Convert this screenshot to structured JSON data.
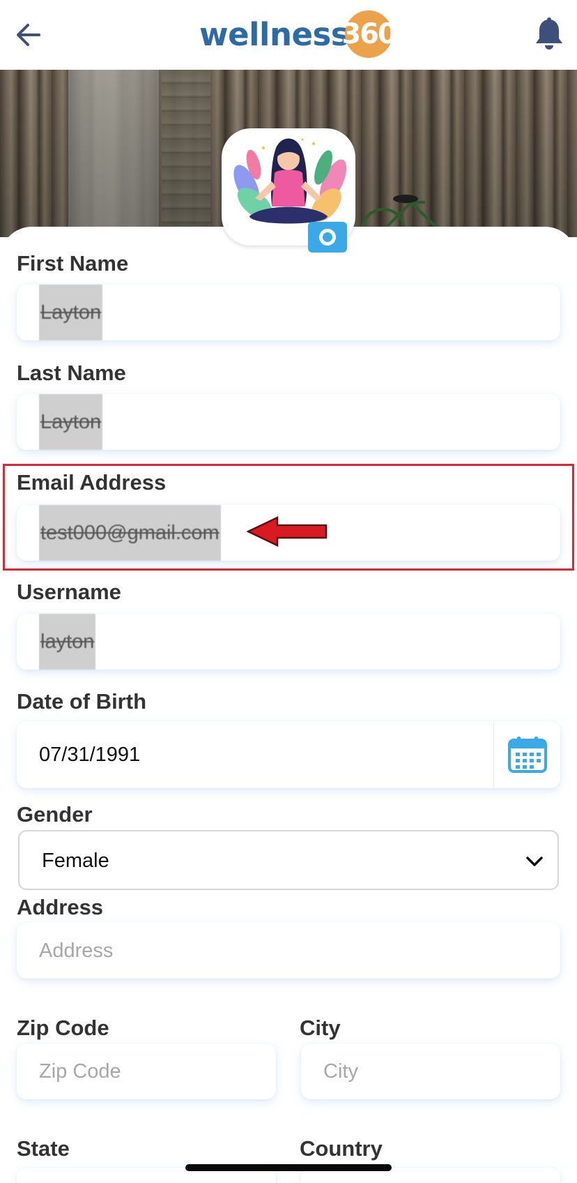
{
  "app": {
    "logo_word": "wellness",
    "logo_number": "360",
    "colors": {
      "brand_blue": "#2d6ba6",
      "brand_orange": "#eca24a",
      "highlight_red": "#e2252f",
      "accent_blue": "#3aa9e8"
    }
  },
  "header": {
    "back_icon": "arrow-left-icon",
    "notification_icon": "bell-icon"
  },
  "profile": {
    "camera_icon": "camera-icon"
  },
  "form": {
    "first_name": {
      "label": "First Name",
      "value": "Layton"
    },
    "last_name": {
      "label": "Last Name",
      "value": "Layton"
    },
    "email": {
      "label": "Email Address",
      "value": "test000@gmail.com"
    },
    "username": {
      "label": "Username",
      "value": "layton"
    },
    "dob": {
      "label": "Date of Birth",
      "value": "07/31/1991",
      "icon": "calendar-icon"
    },
    "gender": {
      "label": "Gender",
      "value": "Female",
      "icon": "chevron-down-icon"
    },
    "address": {
      "label": "Address",
      "placeholder": "Address"
    },
    "zip": {
      "label": "Zip Code",
      "placeholder": "Zip Code"
    },
    "city": {
      "label": "City",
      "placeholder": "City"
    },
    "state": {
      "label": "State"
    },
    "country": {
      "label": "Country"
    }
  }
}
